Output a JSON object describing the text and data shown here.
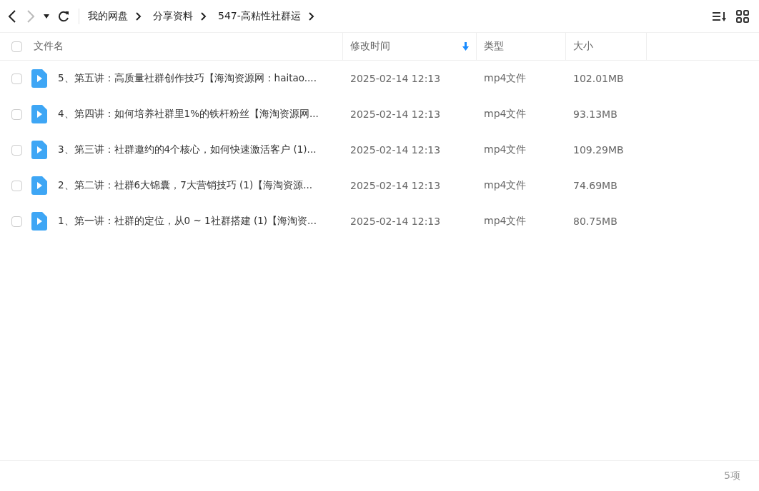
{
  "nav": {
    "back": {
      "disabled": false
    },
    "forward": {
      "disabled": true
    }
  },
  "breadcrumb": [
    "我的网盘",
    "分享资料",
    "547-高粘性社群运"
  ],
  "table": {
    "select_all": {
      "checked": false
    },
    "columns": [
      {
        "label": "文件名",
        "sorted": false
      },
      {
        "label": "修改时间",
        "sorted": true
      },
      {
        "label": "类型",
        "sorted": false
      },
      {
        "label": "大小",
        "sorted": false
      }
    ],
    "rows": [
      {
        "checked": false,
        "name": "5、第五讲：高质量社群创作技巧【海淘资源网：haitao....",
        "modified": "2025-02-14 12:13",
        "type": "mp4文件",
        "size": "102.01MB"
      },
      {
        "checked": false,
        "name": "4、第四讲：如何培养社群里1%的铁杆粉丝【海淘资源网...",
        "modified": "2025-02-14 12:13",
        "type": "mp4文件",
        "size": "93.13MB"
      },
      {
        "checked": false,
        "name": "3、第三讲：社群邀约的4个核心，如何快速激活客户 (1)...",
        "modified": "2025-02-14 12:13",
        "type": "mp4文件",
        "size": "109.29MB"
      },
      {
        "checked": false,
        "name": "2、第二讲：社群6大锦囊，7大营销技巧 (1)【海淘资源...",
        "modified": "2025-02-14 12:13",
        "type": "mp4文件",
        "size": "74.69MB"
      },
      {
        "checked": false,
        "name": "1、第一讲：社群的定位，从0 ~ 1社群搭建 (1)【海淘资...",
        "modified": "2025-02-14 12:13",
        "type": "mp4文件",
        "size": "80.75MB"
      }
    ]
  },
  "status_bar": {
    "count": "5项"
  }
}
